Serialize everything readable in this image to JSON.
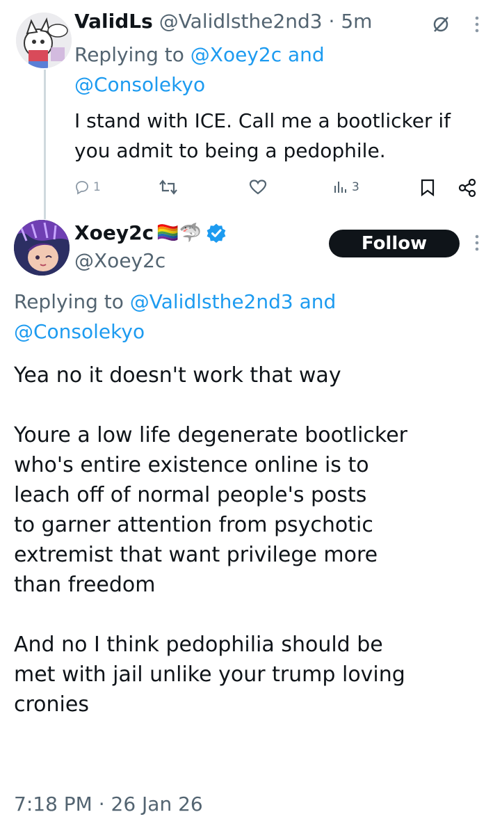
{
  "reply_tweet": {
    "display_name": "ValidLs",
    "handle": "@Validlsthe2nd3",
    "separator": "·",
    "time": "5m",
    "replying_to_prefix": "Replying to",
    "replying_to_1": "@Xoey2c",
    "replying_to_and": "and",
    "replying_to_2": "@Consolekyo",
    "text_line1": "I stand with ICE. Call me a bootlicker if",
    "text_line2": "you admit to being a pedophile.",
    "actions": {
      "reply_count": "1",
      "views_count": "3"
    },
    "icons": [
      "grok-icon",
      "more-icon",
      "reply-icon",
      "retweet-icon",
      "like-icon",
      "views-icon",
      "bookmark-icon",
      "share-icon"
    ]
  },
  "main_tweet": {
    "display_name": "Xoey2c",
    "emojis": "🏳️‍🌈🦈",
    "handle": "@Xoey2c",
    "follow_label": "Follow",
    "replying_to_prefix": "Replying to",
    "replying_to_1": "@Validlsthe2nd3",
    "replying_to_and": "and",
    "replying_to_2": "@Consolekyo",
    "body": "Yea no it doesn't work that way\n\nYoure a low life degenerate bootlicker\nwho's entire existence online is to\nleach off of normal people's posts\nto garner attention from psychotic\nextremist that want privilege more\nthan freedom\n\nAnd no I think pedophilia should be\nmet with jail unlike your trump loving\ncronies",
    "timestamp": "7:18 PM · 26 Jan 26",
    "icons": [
      "verified-badge-icon",
      "more-icon"
    ]
  },
  "colors": {
    "text": "#0f1419",
    "muted": "#536471",
    "link": "#1d9bf0",
    "verified": "#1d9bf0",
    "button": "#0f1419"
  }
}
